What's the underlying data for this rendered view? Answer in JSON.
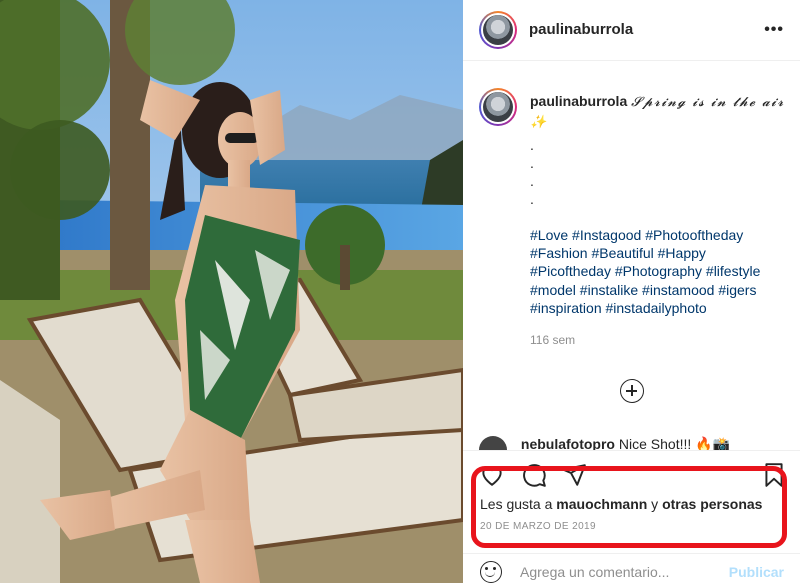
{
  "header": {
    "username": "paulinaburrola",
    "more_icon": "more-horizontal-icon"
  },
  "caption": {
    "username": "paulinaburrola",
    "text": "𝓢𝓹𝓻𝓲𝓷𝓰 𝓲𝓼 𝓲𝓷 𝓽𝓱𝓮 𝓪𝓲𝓻 ✨",
    "dots": [
      ".",
      ".",
      ".",
      "."
    ],
    "hashtags": "#Love #Instagood #Photooftheday #Fashion #Beautiful #Happy #Picoftheday #Photography #lifestyle #model #instalike #instamood #igers #inspiration #instadailyphoto",
    "time_ago": "116 sem"
  },
  "next_comment": {
    "username": "nebulafotopro",
    "text": "Nice Shot!!! 🔥📸"
  },
  "actions": {
    "icons": [
      "heart-icon",
      "comment-icon",
      "share-icon",
      "bookmark-icon"
    ]
  },
  "likes": {
    "prefix": "Les gusta a ",
    "user": "mauochmann",
    "joiner": " y ",
    "others": "otras personas"
  },
  "date": "20 DE MARZO DE 2019",
  "comment_box": {
    "placeholder": "Agrega un comentario...",
    "post_label": "Publicar"
  },
  "colors": {
    "hashtag": "#00376b",
    "highlight": "#e8141c",
    "post_disabled": "#b2dffc"
  }
}
